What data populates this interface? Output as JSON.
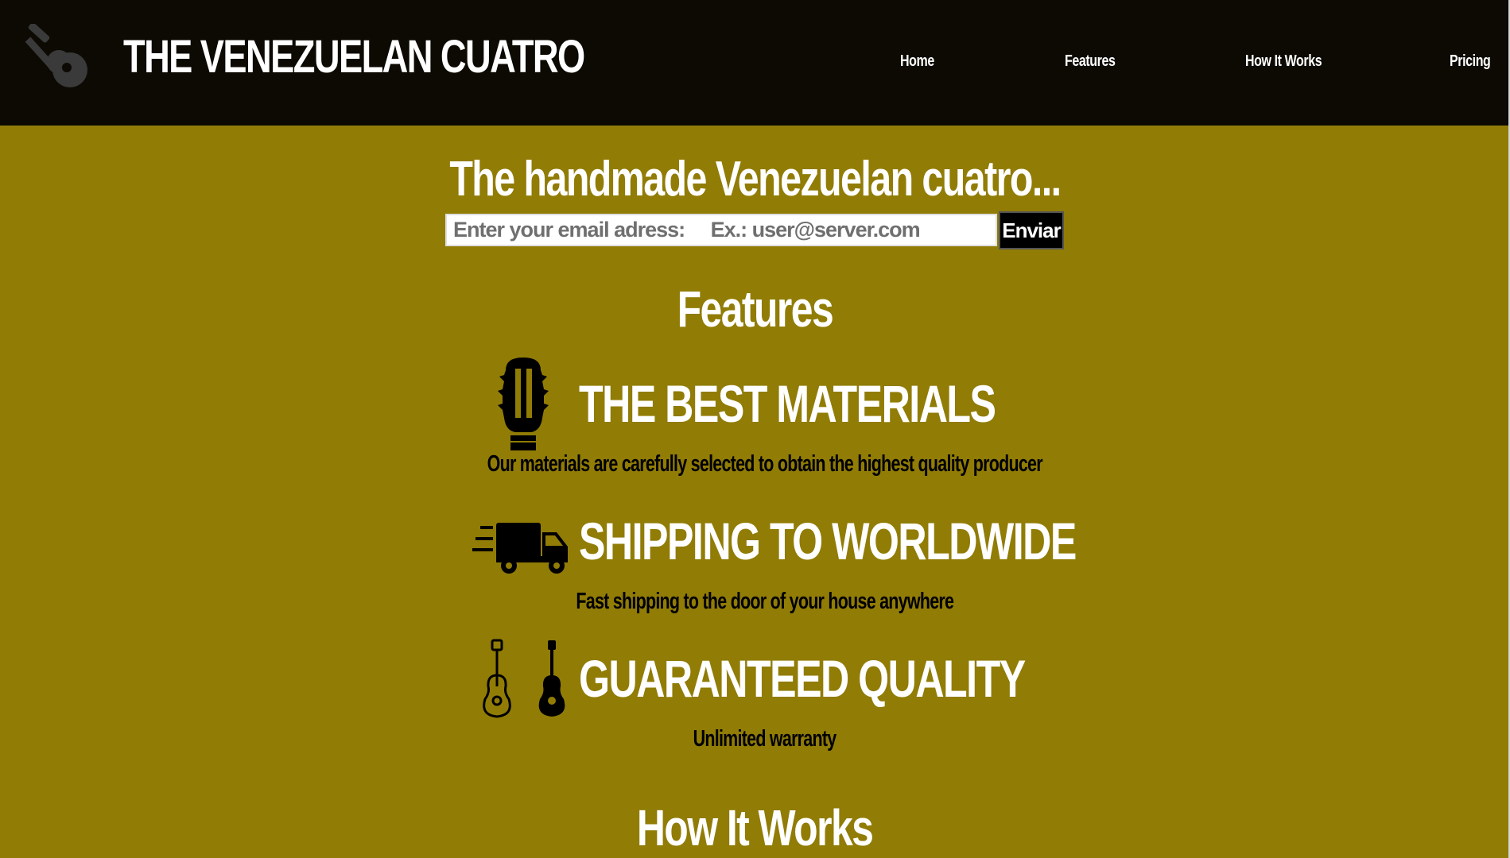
{
  "header": {
    "logo_icon": "guitar-icon",
    "title": "THE VENEZUELAN CUATRO",
    "nav": [
      "Home",
      "Features",
      "How It Works",
      "Pricing"
    ]
  },
  "hero": {
    "title": "The handmade Venezuelan cuatro...",
    "email_placeholder": "Enter your email adress:     Ex.: user@server.com",
    "submit_label": "Enviar"
  },
  "features": {
    "heading": "Features",
    "items": [
      {
        "icon": "guitar-headstock-icon",
        "title": "THE BEST MATERIALS",
        "description": "Our materials are carefully selected to obtain the highest quality producer"
      },
      {
        "icon": "delivery-truck-icon",
        "title": "SHIPPING TO WORLDWIDE",
        "description": "Fast shipping to the door of your house anywhere"
      },
      {
        "icon": "guitars-icon",
        "title": "GUARANTEED QUALITY",
        "description": "Unlimited warranty"
      }
    ]
  },
  "how_it_works": {
    "heading": "How It Works"
  },
  "colors": {
    "background": "#917c06",
    "header_background": "#0c0a02",
    "heading_text": "#ffffff",
    "body_text": "#000000"
  }
}
